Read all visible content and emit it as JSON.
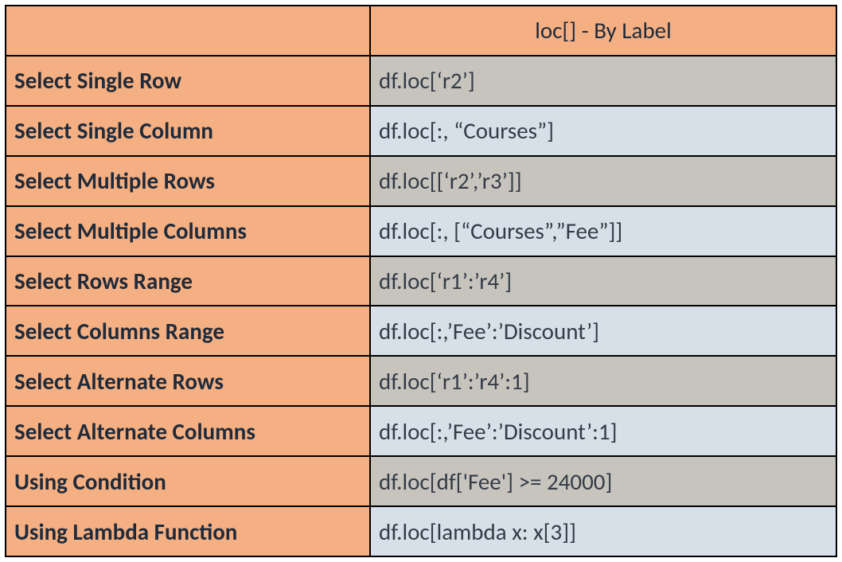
{
  "header": {
    "column_title": "loc[] - By Label"
  },
  "rows": [
    {
      "label": "Select Single Row",
      "code": "df.loc[‘r2’]"
    },
    {
      "label": "Select Single Column",
      "code": "df.loc[:, “Courses”]"
    },
    {
      "label": "Select Multiple Rows",
      "code": "df.loc[[‘r2’,’r3’]]"
    },
    {
      "label": "Select Multiple Columns",
      "code": "df.loc[:, [“Courses”,”Fee”]]"
    },
    {
      "label": "Select Rows Range",
      "code": "df.loc[‘r1’:’r4’]"
    },
    {
      "label": "Select Columns Range",
      "code": "df.loc[:,’Fee’:’Discount’]"
    },
    {
      "label": "Select Alternate Rows",
      "code": "df.loc[‘r1’:’r4’:1]"
    },
    {
      "label": "Select Alternate Columns",
      "code": "df.loc[:,’Fee’:’Discount’:1]"
    },
    {
      "label": "Using Condition",
      "code": "df.loc[df['Fee'] >= 24000]"
    },
    {
      "label": "Using Lambda Function",
      "code": "df.loc[lambda x: x[3]]"
    }
  ]
}
